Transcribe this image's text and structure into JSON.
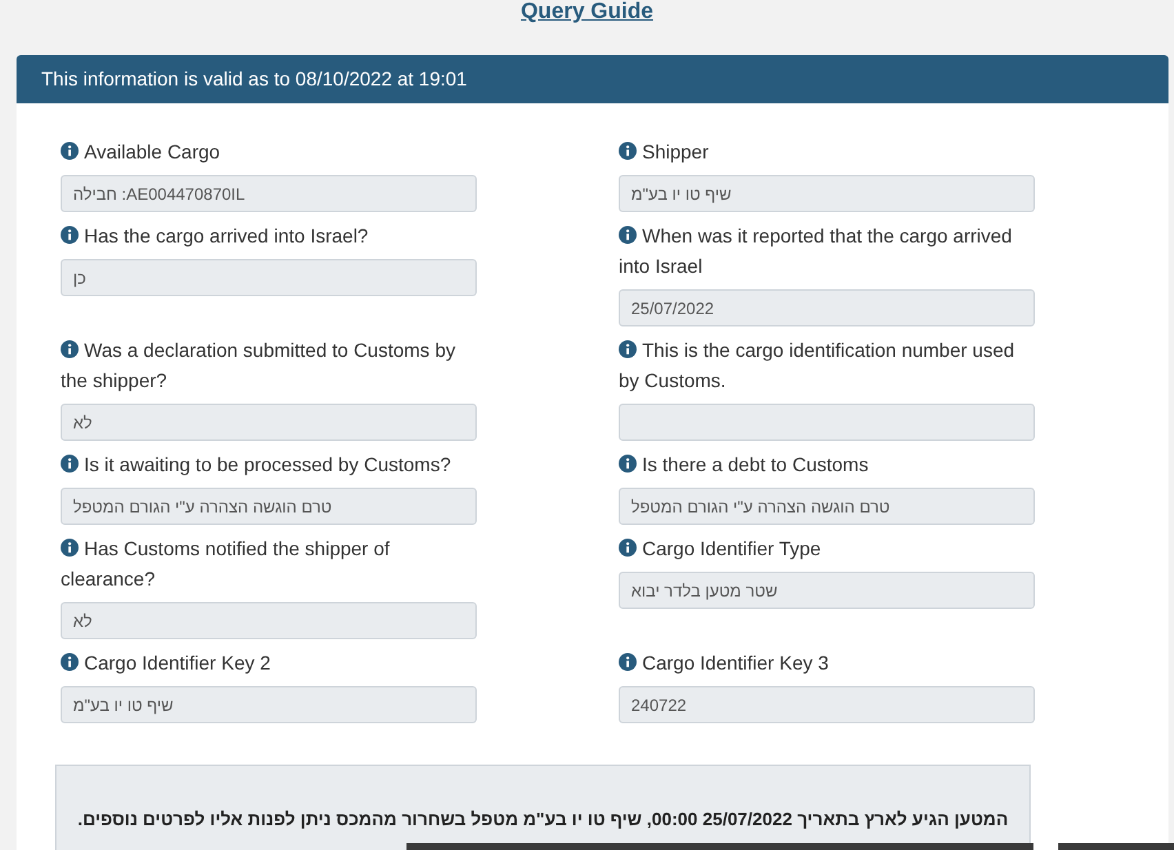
{
  "link": {
    "label": "Query Guide"
  },
  "header": {
    "title": "This information is valid as to 08/10/2022 at 19:01"
  },
  "left_column": [
    {
      "label": "Available Cargo",
      "value": "חבילה :AE004470870IL"
    },
    {
      "label": "Has the cargo arrived into Israel?",
      "value": "כן"
    },
    {
      "label": "Was a declaration submitted to Customs by the shipper?",
      "value": "לא"
    },
    {
      "label": "Is it awaiting to be processed by Customs?",
      "value": "טרם הוגשה הצהרה ע\"י הגורם המטפל"
    },
    {
      "label": "Has Customs notified the shipper of clearance?",
      "value": "לא"
    },
    {
      "label": "Cargo Identifier Key 2",
      "value": "שיף טו יו בע\"מ"
    }
  ],
  "right_column": [
    {
      "label": "Shipper",
      "value": "שיף טו יו בע\"מ"
    },
    {
      "label": "When was it reported that the cargo arrived into Israel",
      "value": "25/07/2022"
    },
    {
      "label": "This is the cargo identification number used by Customs."
    },
    {
      "label": "Is there a debt to Customs",
      "value": "טרם הוגשה הצהרה ע\"י הגורם המטפל"
    },
    {
      "label": "Cargo Identifier Type",
      "value": "שטר מטען בלדר יבוא"
    },
    {
      "label": "Cargo Identifier Key 3",
      "value": "240722"
    }
  ],
  "message": "המטען הגיע לארץ בתאריך 25/07/2022 00:00, שיף טו יו בע\"מ מטפל בשחרור מהמכס ניתן לפנות אליו לפרטים נוספים."
}
